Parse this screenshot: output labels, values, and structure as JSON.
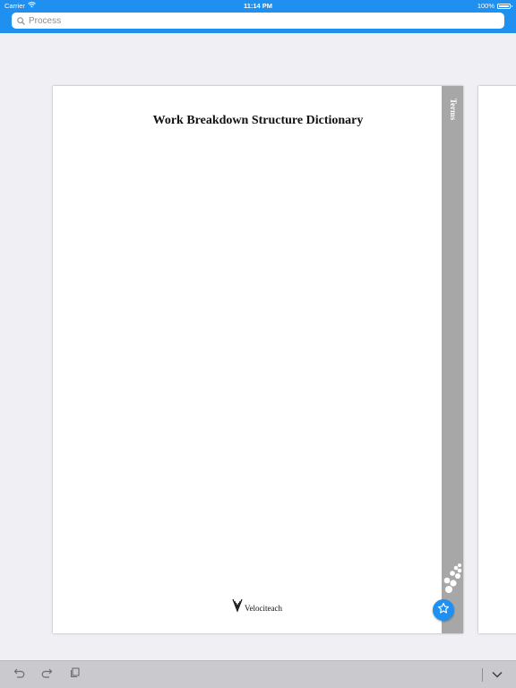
{
  "status_bar": {
    "carrier": "Carrier",
    "time": "11:14 PM",
    "battery": "100%",
    "battery_level": 1.0
  },
  "search": {
    "placeholder": "Process",
    "icon": "search-icon"
  },
  "document": {
    "title": "Work Breakdown Structure Dictionary",
    "tab_label": "Terms",
    "logo_text": "Velociteach"
  },
  "fab": {
    "icon": "star-outline-icon"
  },
  "toolbar": {
    "icons": [
      "undo-icon",
      "redo-icon",
      "pages-icon",
      "chevron-down-icon"
    ]
  },
  "colors": {
    "accent": "#1f8ff0",
    "background": "#efeff4",
    "tab_strip": "#a7a7a7",
    "toolbar": "#c9c9ce"
  }
}
